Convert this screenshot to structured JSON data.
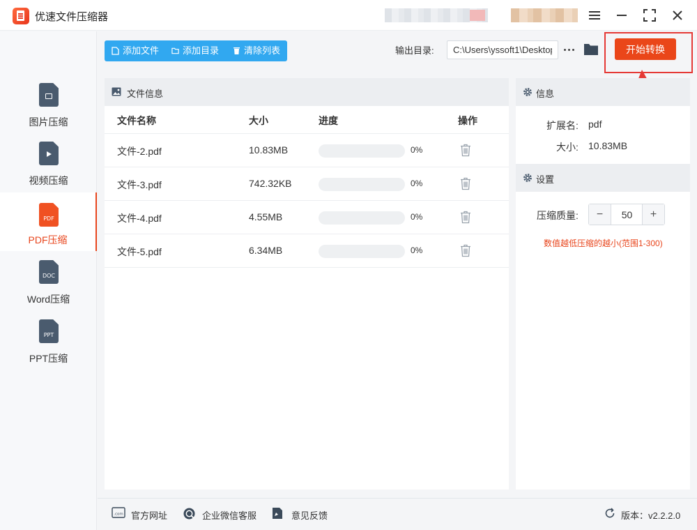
{
  "app": {
    "title": "优速文件压缩器"
  },
  "sidebar": {
    "items": [
      {
        "label": "图片压缩",
        "icon": "image-file-icon"
      },
      {
        "label": "视频压缩",
        "icon": "video-file-icon"
      },
      {
        "label": "PDF压缩",
        "icon": "pdf-file-icon",
        "icon_text": "PDF",
        "active": true
      },
      {
        "label": "Word压缩",
        "icon": "doc-file-icon",
        "icon_text": "DOC"
      },
      {
        "label": "PPT压缩",
        "icon": "ppt-file-icon",
        "icon_text": "PPT"
      }
    ]
  },
  "toolbar": {
    "add_file": "添加文件",
    "add_folder": "添加目录",
    "clear_list": "清除列表",
    "output_label": "输出目录:",
    "output_path": "C:\\Users\\yssoft1\\Desktop",
    "start_button": "开始转换"
  },
  "file_panel": {
    "title": "文件信息",
    "columns": {
      "name": "文件名称",
      "size": "大小",
      "progress": "进度",
      "action": "操作"
    },
    "rows": [
      {
        "name": "文件-2.pdf",
        "size": "10.83MB",
        "progress": 0,
        "progress_text": "0%"
      },
      {
        "name": "文件-3.pdf",
        "size": "742.32KB",
        "progress": 0,
        "progress_text": "0%"
      },
      {
        "name": "文件-4.pdf",
        "size": "4.55MB",
        "progress": 0,
        "progress_text": "0%"
      },
      {
        "name": "文件-5.pdf",
        "size": "6.34MB",
        "progress": 0,
        "progress_text": "0%"
      }
    ]
  },
  "info_panel": {
    "title": "信息",
    "ext_label": "扩展名:",
    "ext_value": "pdf",
    "size_label": "大小:",
    "size_value": "10.83MB"
  },
  "settings_panel": {
    "title": "设置",
    "quality_label": "压缩质量:",
    "quality_value": "50",
    "minus": "−",
    "plus": "+",
    "hint": "数值越低压缩的越小(范围1-300)"
  },
  "footer": {
    "website": "官方网址",
    "wechat": "企业微信客服",
    "feedback": "意见反馈",
    "version": "版本：v2.2.2.0"
  },
  "colors": {
    "accent": "#ea4619",
    "toolbar_blue": "#31a8f0",
    "highlight": "#e53935"
  }
}
